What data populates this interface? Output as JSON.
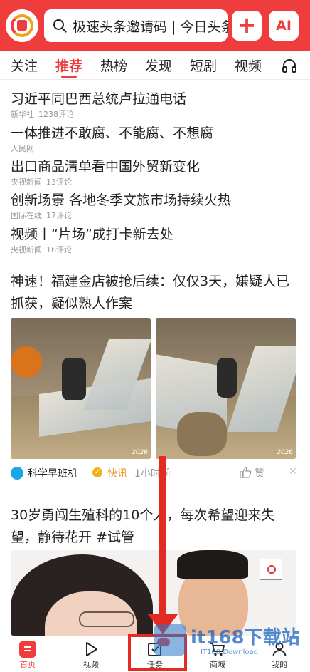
{
  "search": {
    "text": "极速头条邀请码 | 今日头条"
  },
  "header": {
    "plus_label": "+",
    "ai_label": "AI"
  },
  "tabs": [
    {
      "label": "关注"
    },
    {
      "label": "推荐"
    },
    {
      "label": "热榜"
    },
    {
      "label": "发现"
    },
    {
      "label": "短剧"
    },
    {
      "label": "视频"
    }
  ],
  "top_news": [
    {
      "title": "习近平同巴西总统卢拉通电话",
      "source": "新华社",
      "comments": "1238评论"
    },
    {
      "title": "一体推进不敢腐、不能腐、不想腐",
      "source": "人民网",
      "comments": ""
    },
    {
      "title": "出口商品清单看中国外贸新变化",
      "source": "央视新闻",
      "comments": "13评论"
    },
    {
      "title": "创新场景 各地冬季文旅市场持续火热",
      "source": "国际在线",
      "comments": "17评论"
    },
    {
      "title": "视频丨“片场”成打卡新去处",
      "source": "央视新闻",
      "comments": "16评论"
    }
  ],
  "article1": {
    "title": "神速！福建金店被抢后续：仅仅3天，嫌疑人已抓获，疑似熟人作案",
    "image_stamp": "2026",
    "source": "科学早班机",
    "verified_mark": "✓",
    "tag": "快讯",
    "time": "1小时前",
    "like_label": "赞",
    "close": "✕"
  },
  "article2": {
    "title": "30岁勇闯生殖科的10个人，每次希望迎来失望，静待花开 #试管"
  },
  "bottom_nav": [
    {
      "label": "首页"
    },
    {
      "label": "视频"
    },
    {
      "label": "任务"
    },
    {
      "label": "商城"
    },
    {
      "label": "我的"
    }
  ],
  "watermark": {
    "big": "it168下载站",
    "small": "IT168 Download"
  },
  "colors": {
    "brand_red": "#ef3d3d",
    "annotation_red": "#e32b22",
    "tag_orange": "#e39a1a"
  }
}
